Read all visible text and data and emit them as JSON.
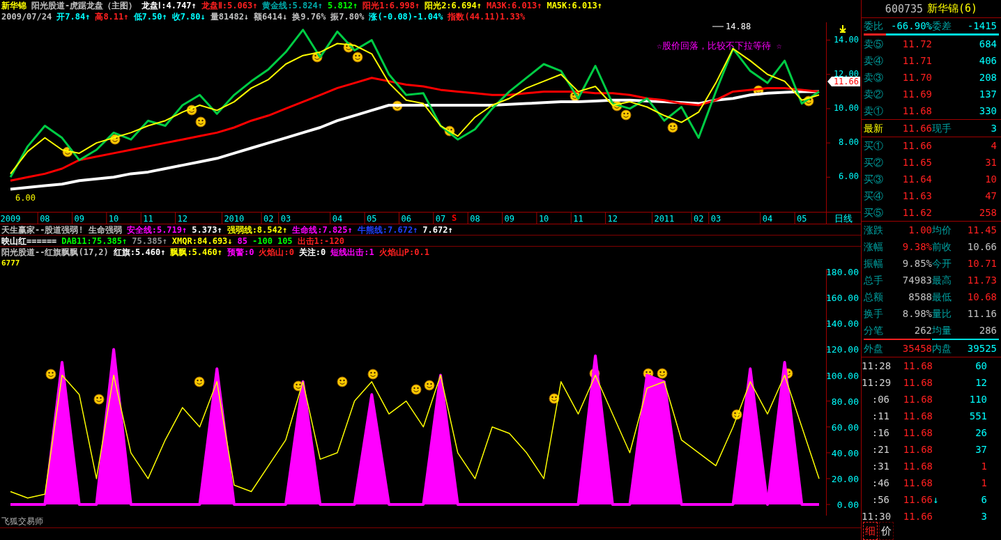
{
  "header": {
    "line1": [
      {
        "text": "新华锦",
        "color": "#ffff00"
      },
      {
        "text": "阳光股道-虎踞龙盘（主图）",
        "color": "#c0c0c0"
      },
      {
        "text": "龙盘Ⅰ:4.747↑",
        "color": "#ffffff"
      },
      {
        "text": "龙盘Ⅱ:5.063↑",
        "color": "#ff2020"
      },
      {
        "text": "黄金线:5.824↑",
        "color": "#00a8a8"
      },
      {
        "text": "5.812↑",
        "color": "#00ff00"
      },
      {
        "text": "阳光1:6.998↑",
        "color": "#ff2020"
      },
      {
        "text": "阳光2:6.694↑",
        "color": "#ffff00"
      },
      {
        "text": "MA3K:6.013↑",
        "color": "#ff2020"
      },
      {
        "text": "MA5K:6.013↑",
        "color": "#ffff00"
      }
    ],
    "line2": [
      {
        "text": "2009/07/24",
        "color": "#c0c0c0"
      },
      {
        "text": "开7.84↑",
        "color": "#00ffff"
      },
      {
        "text": "高8.11↑",
        "color": "#ff2020"
      },
      {
        "text": "低7.50↑",
        "color": "#00ffff"
      },
      {
        "text": "收7.80↓",
        "color": "#00ffff"
      },
      {
        "text": "量81482↓",
        "color": "#c0c0c0"
      },
      {
        "text": "额6414↓",
        "color": "#c0c0c0"
      },
      {
        "text": "换9.76%",
        "color": "#c0c0c0"
      },
      {
        "text": "振7.80%",
        "color": "#c0c0c0"
      },
      {
        "text": "涨(-0.08)-1.04%",
        "color": "#00ffff"
      },
      {
        "text": "指数(44.11)1.33%",
        "color": "#ff2020"
      }
    ]
  },
  "price_chart": {
    "last_price_tag": "11.66",
    "period": "日线",
    "peak_label": "14.88",
    "note": "☆股价回落，比较不下拉等待 ☆",
    "low_label": "6.00",
    "signal": "S",
    "chart_data": {
      "type": "line",
      "categories": [
        "2009",
        null,
        "08",
        null,
        "09",
        null,
        "10",
        null,
        "11",
        null,
        "12",
        null,
        null,
        "2010",
        null,
        "02",
        "03",
        null,
        null,
        "04",
        null,
        "05",
        null,
        "06",
        null,
        "07",
        null,
        "08",
        null,
        "09",
        null,
        "10",
        null,
        "11",
        null,
        "12",
        null,
        null,
        "2011",
        null,
        "02",
        "03",
        null,
        null,
        "04",
        null,
        "05",
        null
      ],
      "ylim": [
        3.98,
        15.04
      ],
      "yticks": [
        {
          "value": 6,
          "label": "6.00"
        },
        {
          "value": 8,
          "label": "8.00"
        },
        {
          "value": 10,
          "label": "10.00"
        },
        {
          "value": 12,
          "label": "12.00"
        },
        {
          "value": 14,
          "label": "14.00"
        }
      ],
      "series": [
        {
          "color": "#ffffff",
          "values": [
            5.3,
            5.4,
            5.5,
            5.6,
            5.8,
            5.9,
            6.0,
            6.2,
            6.3,
            6.5,
            6.7,
            6.9,
            7.1,
            7.4,
            7.7,
            8.0,
            8.3,
            8.6,
            8.9,
            9.3,
            9.6,
            9.9,
            10.2,
            10.2,
            10.2,
            10.2,
            10.2,
            10.2,
            10.2,
            10.25,
            10.3,
            10.35,
            10.4,
            10.4,
            10.45,
            10.5,
            10.5,
            10.45,
            10.4,
            10.35,
            10.3,
            10.5,
            10.6,
            10.8,
            10.9,
            10.95,
            11.0,
            11.0
          ]
        },
        {
          "color": "#ff0000",
          "values": [
            5.8,
            6.0,
            6.2,
            6.5,
            7.0,
            7.2,
            7.4,
            7.6,
            7.8,
            8.0,
            8.2,
            8.4,
            8.6,
            8.9,
            9.3,
            9.6,
            10.0,
            10.4,
            10.8,
            11.2,
            11.5,
            11.8,
            11.6,
            11.4,
            11.3,
            11.1,
            11.0,
            10.9,
            10.8,
            10.8,
            10.9,
            11.0,
            11.0,
            11.0,
            10.9,
            10.9,
            10.8,
            10.6,
            10.5,
            10.3,
            10.2,
            10.5,
            11.0,
            11.1,
            11.2,
            11.2,
            11.1,
            11.0
          ]
        },
        {
          "color": "#00cc44",
          "values": [
            6.0,
            7.8,
            9.0,
            8.3,
            7.0,
            7.6,
            8.6,
            8.2,
            9.3,
            9.0,
            10.2,
            10.8,
            9.7,
            10.8,
            11.6,
            12.3,
            13.3,
            14.6,
            13.0,
            14.5,
            13.4,
            14.0,
            12.0,
            10.8,
            10.9,
            9.0,
            8.2,
            8.8,
            10.0,
            11.0,
            11.8,
            12.6,
            12.2,
            10.6,
            12.5,
            10.3,
            10.0,
            10.6,
            9.3,
            10.1,
            8.3,
            11.0,
            13.5,
            12.2,
            11.5,
            12.8,
            10.3,
            11.0
          ]
        },
        {
          "color": "#ffff00",
          "values": [
            6.2,
            7.5,
            8.3,
            7.6,
            7.4,
            8.0,
            8.3,
            8.6,
            9.0,
            9.3,
            9.8,
            10.2,
            9.9,
            10.4,
            11.2,
            11.7,
            12.6,
            13.1,
            13.3,
            13.8,
            13.7,
            13.2,
            11.5,
            10.5,
            10.3,
            9.0,
            8.4,
            9.5,
            10.2,
            10.6,
            11.2,
            11.6,
            12.0,
            11.0,
            11.3,
            10.2,
            10.4,
            10.1,
            9.6,
            9.2,
            9.8,
            11.5,
            13.5,
            12.8,
            12.0,
            11.6,
            10.5,
            10.8
          ]
        }
      ]
    }
  },
  "indicator_lines": [
    {
      "items": [
        {
          "text": "天生赢家--股道强弱!",
          "color": "#c0c0c0"
        },
        {
          "text": "生命强弱",
          "color": "#c0c0c0"
        },
        {
          "text": "安全线:5.719↑",
          "color": "#ff00ff"
        },
        {
          "text": "5.373↑",
          "color": "#ffffff"
        },
        {
          "text": "强弱线:8.542↑",
          "color": "#ffff00"
        },
        {
          "text": "生命线:7.825↑",
          "color": "#ff00ff"
        },
        {
          "text": "牛熊线:7.672↑",
          "color": "#2040ff"
        },
        {
          "text": "7.672↑",
          "color": "#ffffff"
        }
      ]
    },
    {
      "items": [
        {
          "text": "映山红======",
          "color": "#ffffff"
        },
        {
          "text": "DAB11:75.385↑",
          "color": "#00ff00"
        },
        {
          "text": "75.385↑",
          "color": "#909090"
        },
        {
          "text": "XMQR:84.693↓",
          "color": "#ffff00"
        },
        {
          "text": "85",
          "color": "#ff00ff"
        },
        {
          "text": "-100",
          "color": "#00ff00"
        },
        {
          "text": "105",
          "color": "#00ff00"
        },
        {
          "text": "出击1:-120",
          "color": "#ff2020"
        }
      ]
    }
  ],
  "oscillator": {
    "title_items": [
      {
        "text": "阳光股道--红旗飘飘(17,2)",
        "color": "#c0c0c0"
      },
      {
        "text": "红旗:5.460↑",
        "color": "#ffffff"
      },
      {
        "text": "飘飘:5.460↑",
        "color": "#ffff00"
      },
      {
        "text": "预警:0",
        "color": "#ff00ff"
      },
      {
        "text": "火焰山:0",
        "color": "#ff2020"
      },
      {
        "text": "关注:0",
        "color": "#ffffff"
      },
      {
        "text": "短线出击:1",
        "color": "#ff00ff"
      },
      {
        "text": "火焰山P:0.1",
        "color": "#ff2020"
      }
    ],
    "value": "6777",
    "chart_data": {
      "type": "line",
      "categories": [
        null,
        null,
        null,
        null,
        null,
        null,
        null,
        null,
        null,
        null,
        null,
        null,
        null,
        null,
        null,
        null,
        null,
        null,
        null,
        null,
        null,
        null,
        null,
        null,
        null,
        null,
        null,
        null,
        null,
        null,
        null,
        null,
        null,
        null,
        null,
        null,
        null,
        null,
        null,
        null,
        null,
        null,
        null,
        null,
        null,
        null,
        null,
        null
      ],
      "ylim": [
        -8.6,
        182.2
      ],
      "yticks": [
        {
          "value": 0,
          "label": "0.00"
        },
        {
          "value": 20,
          "label": "20.00"
        },
        {
          "value": 40,
          "label": "40.00"
        },
        {
          "value": 60,
          "label": "60.00"
        },
        {
          "value": 80,
          "label": "80.00"
        },
        {
          "value": 100,
          "label": "100.00"
        },
        {
          "value": 120,
          "label": "120.00"
        },
        {
          "value": 140,
          "label": "140.00"
        },
        {
          "value": 160,
          "label": "160.00"
        },
        {
          "value": 180,
          "label": "180.00"
        }
      ],
      "series": [
        {
          "color": "#ff00ff",
          "values": [
            0,
            0,
            0,
            110,
            0,
            0,
            120,
            0,
            0,
            0,
            0,
            0,
            105,
            0,
            0,
            0,
            0,
            95,
            0,
            0,
            0,
            85,
            0,
            0,
            0,
            100,
            0,
            0,
            0,
            0,
            0,
            0,
            0,
            0,
            115,
            0,
            0,
            100,
            95,
            0,
            0,
            0,
            0,
            105,
            0,
            110,
            0,
            0
          ]
        },
        {
          "color": "#ffff00",
          "values": [
            10,
            5,
            8,
            100,
            85,
            20,
            100,
            40,
            20,
            50,
            75,
            60,
            95,
            15,
            10,
            30,
            50,
            95,
            35,
            40,
            80,
            95,
            70,
            80,
            60,
            100,
            40,
            20,
            60,
            55,
            40,
            20,
            95,
            70,
            100,
            70,
            40,
            90,
            95,
            50,
            40,
            30,
            60,
            95,
            70,
            100,
            60,
            20
          ]
        }
      ]
    }
  },
  "footer": "飞狐交易师",
  "quote_panel": {
    "code": "600735",
    "name": "新华锦(6)",
    "ratio": {
      "label": "委比",
      "value": "-66.90%",
      "diff_label": "委差",
      "diff": "-1415",
      "level": 0.165
    },
    "sells": [
      {
        "label": "卖⑤",
        "price": "11.72",
        "volume": "684"
      },
      {
        "label": "卖④",
        "price": "11.71",
        "volume": "406"
      },
      {
        "label": "卖③",
        "price": "11.70",
        "volume": "208"
      },
      {
        "label": "卖②",
        "price": "11.69",
        "volume": "137"
      },
      {
        "label": "卖①",
        "price": "11.68",
        "volume": "330"
      }
    ],
    "last": {
      "label": "最新",
      "price": "11.66",
      "vol_label": "现手",
      "volume": "3"
    },
    "buys": [
      {
        "label": "买①",
        "price": "11.66",
        "volume": "4"
      },
      {
        "label": "买②",
        "price": "11.65",
        "volume": "31"
      },
      {
        "label": "买③",
        "price": "11.64",
        "volume": "10"
      },
      {
        "label": "买④",
        "price": "11.63",
        "volume": "47"
      },
      {
        "label": "买⑤",
        "price": "11.62",
        "volume": "258"
      }
    ],
    "stats": [
      {
        "label": "涨跌",
        "value": "1.00",
        "color": "#ff2020"
      },
      {
        "label": "均价",
        "value": "11.45",
        "color": "#ff2020"
      },
      {
        "label": "涨幅",
        "value": "9.38%",
        "color": "#ff2020"
      },
      {
        "label": "前收",
        "value": "10.66",
        "color": "#c0c0c0"
      },
      {
        "label": "振幅",
        "value": "9.85%",
        "color": "#c0c0c0"
      },
      {
        "label": "今开",
        "value": "10.71",
        "color": "#ff2020"
      },
      {
        "label": "总手",
        "value": "74983",
        "color": "#c0c0c0"
      },
      {
        "label": "最高",
        "value": "11.73",
        "color": "#ff2020"
      },
      {
        "label": "总额",
        "value": "8588",
        "color": "#c0c0c0"
      },
      {
        "label": "最低",
        "value": "10.68",
        "color": "#ff2020"
      },
      {
        "label": "换手",
        "value": "8.98%",
        "color": "#c0c0c0"
      },
      {
        "label": "量比",
        "value": "11.16",
        "color": "#c0c0c0"
      },
      {
        "label": "分笔",
        "value": "262",
        "color": "#c0c0c0"
      },
      {
        "label": "均量",
        "value": "286",
        "color": "#c0c0c0"
      }
    ],
    "outer": {
      "label": "外盘",
      "value": "35458"
    },
    "inner": {
      "label": "内盘",
      "value": "39525"
    },
    "ticks": [
      {
        "time": "11:28",
        "price": "11.68",
        "volume": "60",
        "color": "#00ffff"
      },
      {
        "time": "11:29",
        "price": "11.68",
        "volume": "12",
        "color": "#00ffff"
      },
      {
        "time": ":06",
        "price": "11.68",
        "volume": "110",
        "color": "#00ffff"
      },
      {
        "time": ":11",
        "price": "11.68",
        "volume": "551",
        "color": "#00ffff"
      },
      {
        "time": ":16",
        "price": "11.68",
        "volume": "26",
        "color": "#00ffff"
      },
      {
        "time": ":21",
        "price": "11.68",
        "volume": "37",
        "color": "#00ffff"
      },
      {
        "time": ":31",
        "price": "11.68",
        "volume": "1",
        "color": "#ff2020"
      },
      {
        "time": ":46",
        "price": "11.68",
        "volume": "1",
        "color": "#ff2020"
      },
      {
        "time": ":56",
        "price": "11.66",
        "arrow": "↓",
        "volume": "6",
        "color": "#00ffff"
      },
      {
        "time": "11:30",
        "price": "11.66",
        "volume": "3",
        "color": "#00ffff"
      }
    ],
    "tabs": [
      {
        "label": "细",
        "selected": true
      },
      {
        "label": "价",
        "selected": false
      }
    ]
  }
}
